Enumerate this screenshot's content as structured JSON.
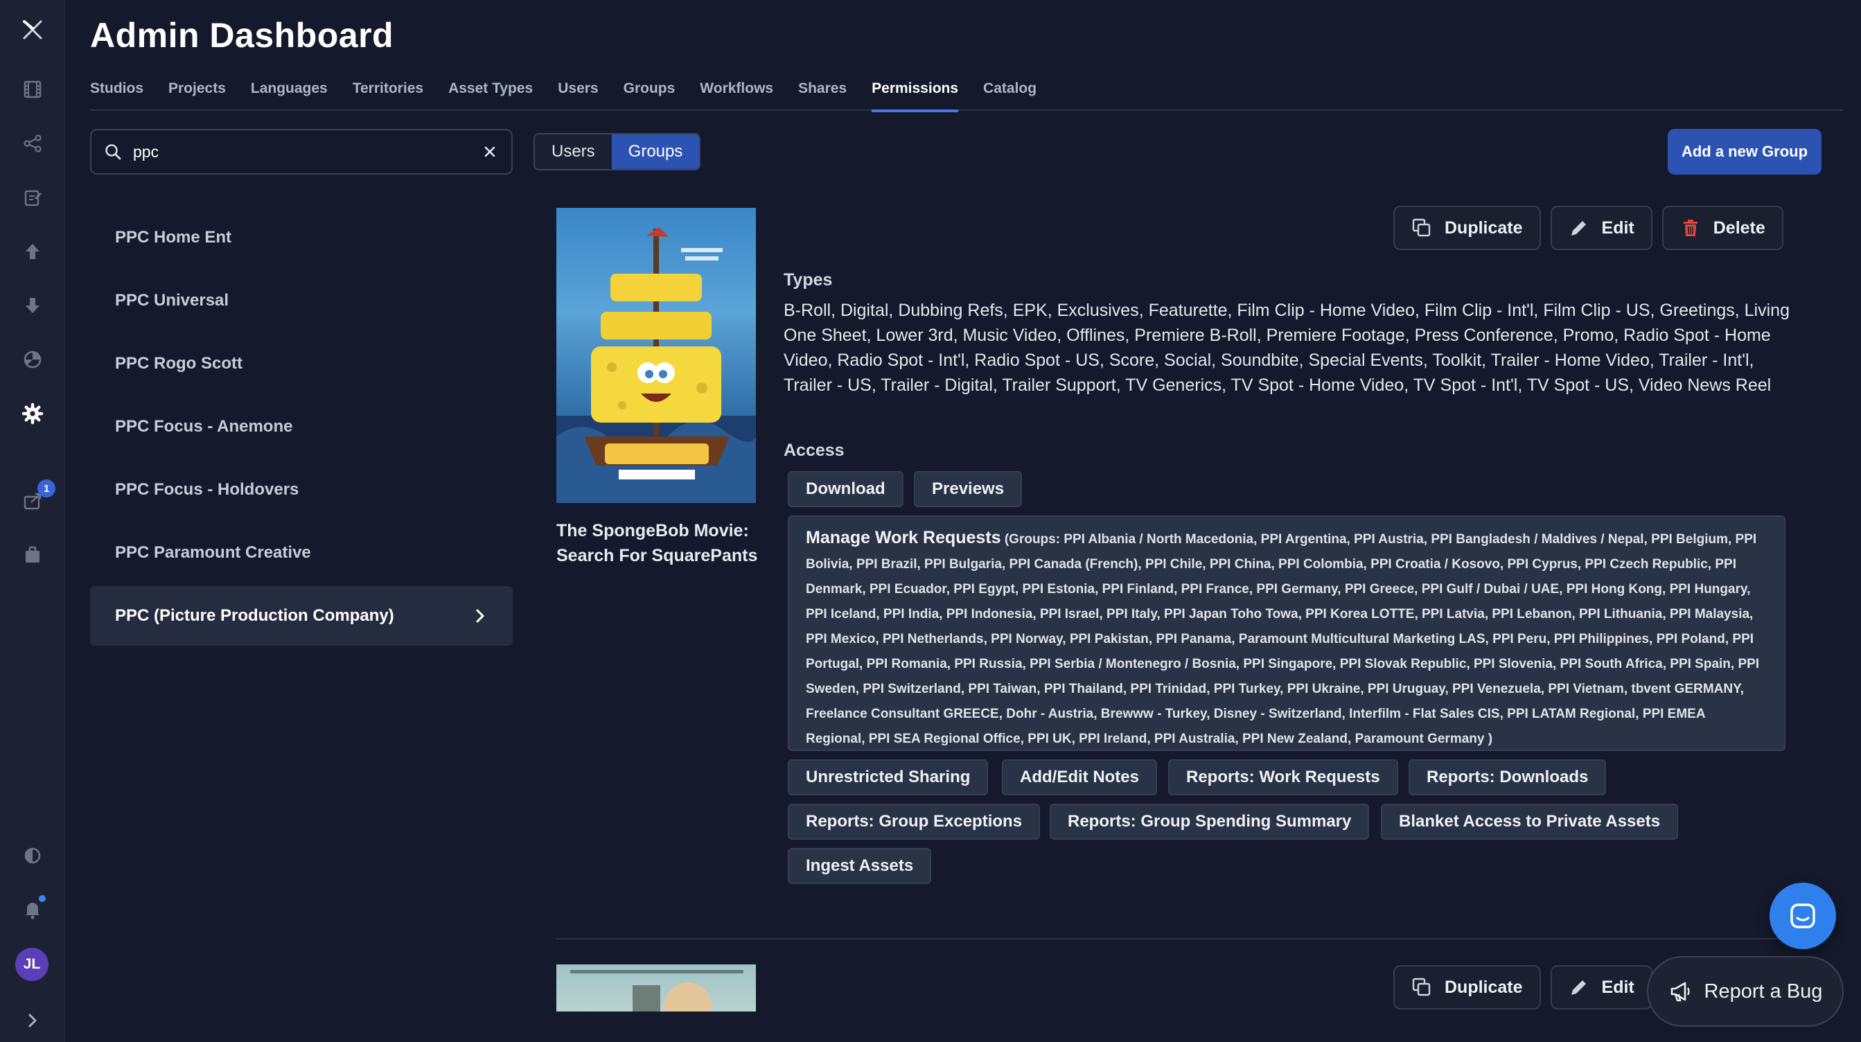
{
  "header": {
    "title": "Admin Dashboard"
  },
  "tabs": [
    {
      "label": "Studios"
    },
    {
      "label": "Projects"
    },
    {
      "label": "Languages"
    },
    {
      "label": "Territories"
    },
    {
      "label": "Asset Types"
    },
    {
      "label": "Users"
    },
    {
      "label": "Groups"
    },
    {
      "label": "Workflows"
    },
    {
      "label": "Shares"
    },
    {
      "label": "Permissions",
      "active": true
    },
    {
      "label": "Catalog"
    }
  ],
  "rail": {
    "badge_count": "1",
    "avatar_initials": "JL"
  },
  "search": {
    "value": "ppc"
  },
  "toggle": {
    "users": "Users",
    "groups": "Groups"
  },
  "add_group_label": "Add a new Group",
  "groups": [
    "PPC Home Ent",
    "PPC Universal",
    "PPC Rogo Scott",
    "PPC Focus - Anemone",
    "PPC Focus - Holdovers",
    "PPC Paramount Creative",
    "PPC (Picture Production Company)"
  ],
  "card": {
    "poster_title": "The SpongeBob Movie: Search For SquarePants",
    "actions": {
      "duplicate": "Duplicate",
      "edit": "Edit",
      "delete": "Delete"
    },
    "types_label": "Types",
    "types": "B-Roll, Digital, Dubbing Refs, EPK, Exclusives, Featurette, Film Clip - Home Video, Film Clip - Int'l, Film Clip - US, Greetings, Living One Sheet, Lower 3rd, Music Video, Offlines, Premiere B-Roll, Premiere Footage, Press Conference, Promo, Radio Spot - Home Video, Radio Spot - Int'l, Radio Spot - US, Score, Social, Soundbite, Special Events, Toolkit, Trailer - Home Video, Trailer - Int'l, Trailer - US, Trailer - Digital, Trailer Support, TV Generics, TV Spot - Home Video, TV Spot - Int'l, TV Spot - US, Video News Reel",
    "access_label": "Access",
    "access": {
      "download": "Download",
      "previews": "Previews",
      "manage_title": "Manage Work Requests",
      "manage_groups": "(Groups: PPI Albania / North Macedonia, PPI Argentina, PPI Austria, PPI Bangladesh / Maldives / Nepal, PPI Belgium, PPI Bolivia, PPI Brazil, PPI Bulgaria, PPI Canada (French), PPI Chile, PPI China, PPI Colombia, PPI Croatia / Kosovo, PPI Cyprus, PPI Czech Republic, PPI Denmark, PPI Ecuador, PPI Egypt, PPI Estonia, PPI Finland, PPI France, PPI Germany, PPI Greece, PPI Gulf / Dubai / UAE, PPI Hong Kong, PPI Hungary, PPI Iceland, PPI India, PPI Indonesia, PPI Israel, PPI Italy, PPI Japan Toho Towa, PPI Korea LOTTE, PPI Latvia, PPI Lebanon, PPI Lithuania, PPI Malaysia, PPI Mexico, PPI Netherlands, PPI Norway, PPI Pakistan, PPI Panama, Paramount Multicultural Marketing LAS, PPI Peru, PPI Philippines, PPI Poland, PPI Portugal, PPI Romania, PPI Russia, PPI Serbia / Montenegro / Bosnia, PPI Singapore, PPI Slovak Republic, PPI Slovenia, PPI South Africa, PPI Spain, PPI Sweden, PPI Switzerland, PPI Taiwan, PPI Thailand, PPI Trinidad, PPI Turkey, PPI Ukraine, PPI Uruguay, PPI Venezuela, PPI Vietnam, tbvent GERMANY, Freelance Consultant GREECE, Dohr - Austria, Brewww - Turkey, Disney - Switzerland, Interfilm - Flat Sales CIS, PPI LATAM Regional, PPI EMEA Regional, PPI SEA Regional Office, PPI UK, PPI Ireland, PPI Australia, PPI New Zealand, Paramount Germany )",
      "unrestricted_sharing": "Unrestricted Sharing",
      "add_edit_notes": "Add/Edit Notes",
      "reports_work_requests": "Reports: Work Requests",
      "reports_downloads": "Reports: Downloads",
      "reports_group_exceptions": "Reports: Group Exceptions",
      "reports_group_spending": "Reports: Group Spending Summary",
      "blanket_access": "Blanket Access to Private Assets",
      "ingest_assets": "Ingest Assets"
    }
  },
  "card2": {
    "actions": {
      "duplicate": "Duplicate",
      "edit": "Edit"
    }
  },
  "report_bug_label": "Report a Bug"
}
